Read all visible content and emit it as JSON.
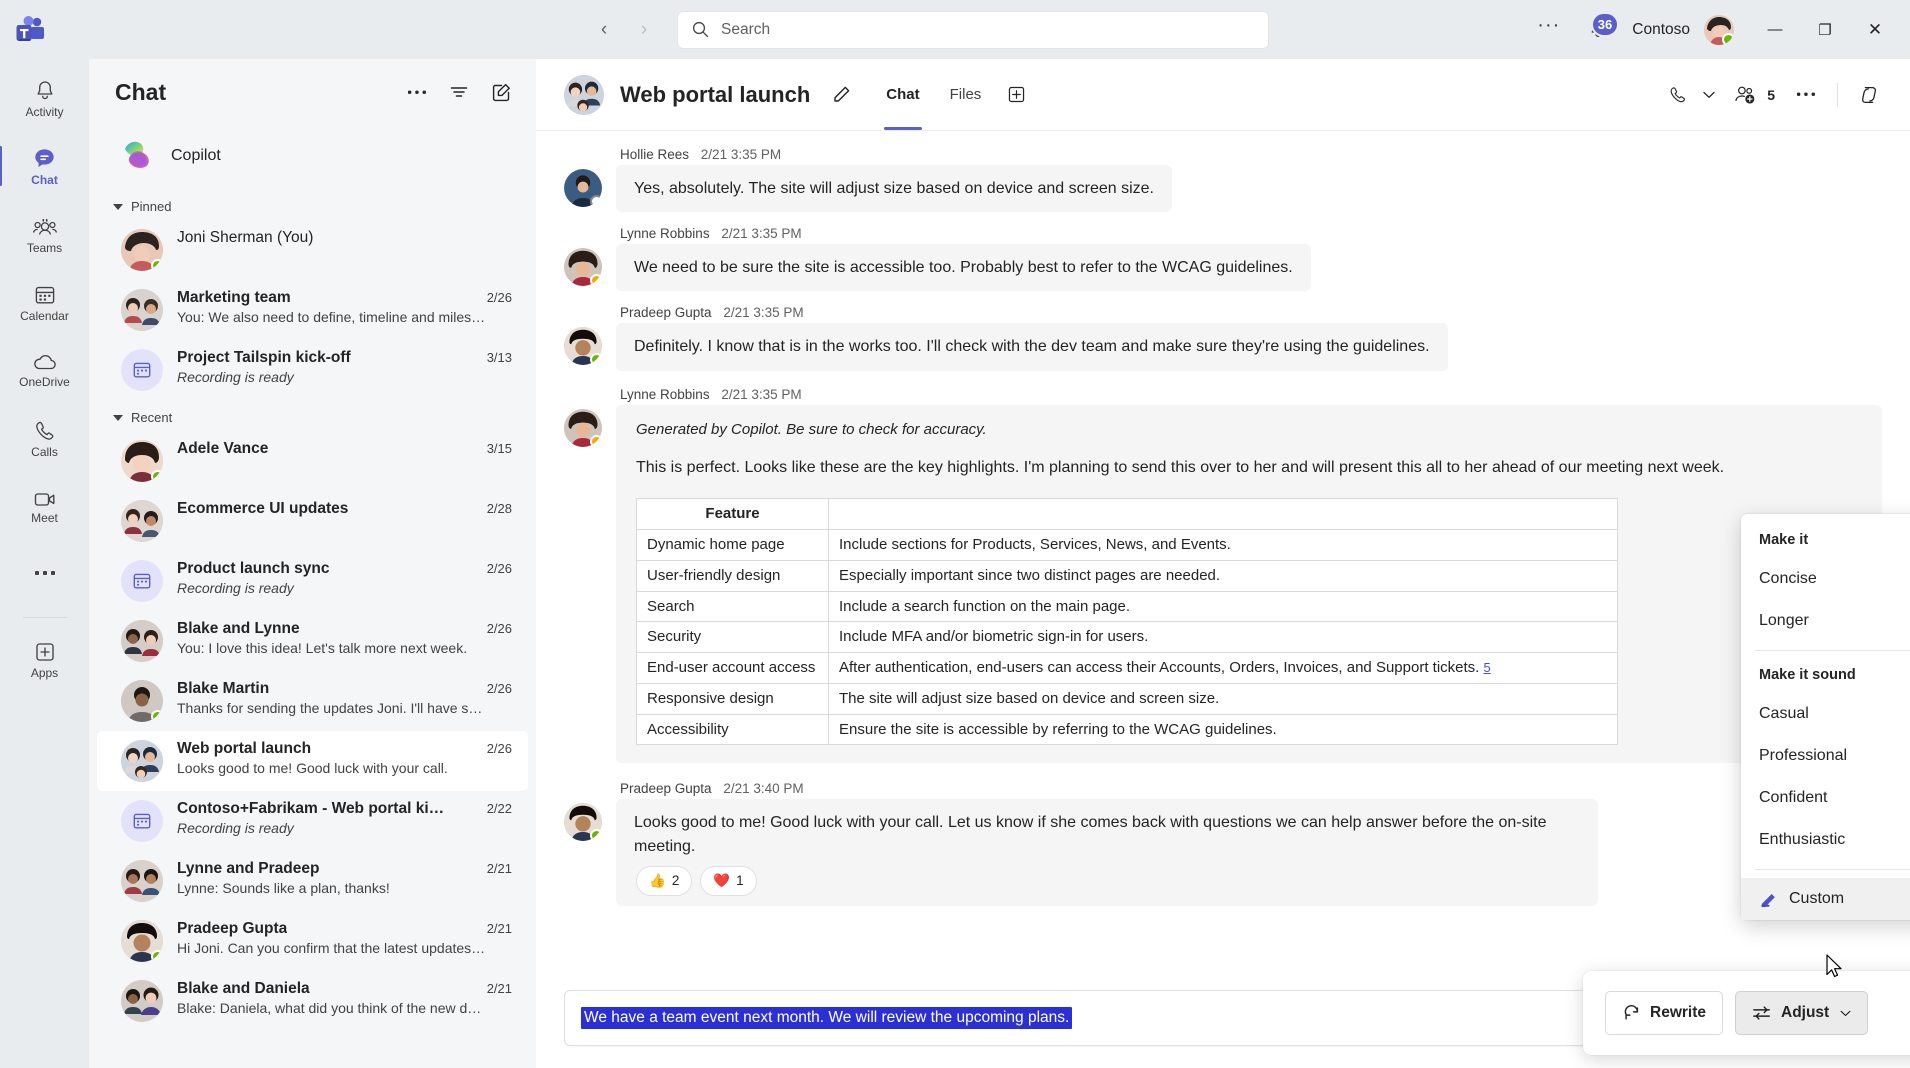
{
  "titlebar": {
    "logo_name": "teams-logo",
    "back_label": "‹",
    "forward_label": "›",
    "search_placeholder": "Search",
    "overflow_label": "···",
    "notification_count": "36",
    "org_name": "Contoso",
    "minimize_label": "—",
    "maximize_label": "❐",
    "close_label": "✕"
  },
  "rail": {
    "items": [
      {
        "label": "Activity",
        "icon": "bell-icon"
      },
      {
        "label": "Chat",
        "icon": "chat-icon"
      },
      {
        "label": "Teams",
        "icon": "teams-people-icon"
      },
      {
        "label": "Calendar",
        "icon": "calendar-icon"
      },
      {
        "label": "OneDrive",
        "icon": "cloud-icon"
      },
      {
        "label": "Calls",
        "icon": "phone-icon"
      },
      {
        "label": "Meet",
        "icon": "video-icon"
      },
      {
        "label": "",
        "icon": "more-icon"
      },
      {
        "label": "Apps",
        "icon": "apps-plus-icon"
      }
    ],
    "active_index": 1,
    "accent": "#5b5fc7"
  },
  "chatlist": {
    "title": "Chat",
    "actions": [
      "more-options-icon",
      "filter-icon",
      "compose-chat-icon"
    ],
    "copilot": {
      "label": "Copilot"
    },
    "groups": [
      {
        "label": "Pinned",
        "items": [
          {
            "name": "Joni Sherman (You)",
            "date": "",
            "preview": "",
            "icon": "avatar",
            "presence": "available"
          },
          {
            "name": "Marketing team",
            "date": "2/26",
            "preview": "You: We also need to define, timeline and miles…",
            "icon": "group-avatar",
            "presence": ""
          },
          {
            "name": "Project Tailspin kick-off",
            "date": "3/13",
            "preview": "Recording is ready",
            "preview_italic": true,
            "icon": "meeting-icon",
            "presence": ""
          }
        ]
      },
      {
        "label": "Recent",
        "items": [
          {
            "name": "Adele Vance",
            "date": "3/15",
            "preview": "",
            "icon": "avatar",
            "presence": "available"
          },
          {
            "name": "Ecommerce UI updates",
            "date": "2/28",
            "preview": "",
            "icon": "group-avatar",
            "presence": ""
          },
          {
            "name": "Product launch sync",
            "date": "2/26",
            "preview": "Recording is ready",
            "preview_italic": true,
            "icon": "meeting-icon",
            "presence": ""
          },
          {
            "name": "Blake and Lynne",
            "date": "2/26",
            "preview": "You: I love this idea! Let's talk more next week.",
            "icon": "group-avatar",
            "presence": ""
          },
          {
            "name": "Blake Martin",
            "date": "2/26",
            "preview": "Thanks for sending the updates Joni. I'll have s…",
            "icon": "avatar",
            "presence": "available"
          },
          {
            "name": "Web portal launch",
            "date": "2/26",
            "preview": "Looks good to me! Good luck with your call.",
            "icon": "group-avatar",
            "presence": "",
            "selected": true
          },
          {
            "name": "Contoso+Fabrikam - Web portal ki…",
            "date": "2/22",
            "preview": "Recording is ready",
            "preview_italic": true,
            "icon": "meeting-icon",
            "presence": ""
          },
          {
            "name": "Lynne and Pradeep",
            "date": "2/21",
            "preview": "Lynne: Sounds like a plan, thanks!",
            "icon": "group-avatar",
            "presence": ""
          },
          {
            "name": "Pradeep Gupta",
            "date": "2/21",
            "preview": "Hi Joni. Can you confirm that the latest updates…",
            "icon": "avatar",
            "presence": "available"
          },
          {
            "name": "Blake and Daniela",
            "date": "2/21",
            "preview": "Blake: Daniela, what did you think of the new d…",
            "icon": "group-avatar",
            "presence": ""
          }
        ]
      }
    ]
  },
  "chat_header": {
    "title": "Web portal launch",
    "edit_icon": "pencil-icon",
    "tabs": [
      {
        "label": "Chat",
        "active": true
      },
      {
        "label": "Files",
        "active": false
      }
    ],
    "add_tab_icon": "add-tab-icon",
    "call_icon": "phone-icon",
    "call_chevron": "chevron-down-icon",
    "people_icon": "add-people-icon",
    "people_count": "5",
    "more_icon": "more-options-icon",
    "copilot_icon": "copilot-icon"
  },
  "messages": [
    {
      "sender": "Hollie Rees",
      "time": "2/21 3:35 PM",
      "presence": "offline",
      "text": "Yes, absolutely. The site will adjust size based on device and screen size."
    },
    {
      "sender": "Lynne Robbins",
      "time": "2/21 3:35 PM",
      "presence": "away",
      "text": "We need to be sure the site is accessible too. Probably best to refer to the WCAG guidelines."
    },
    {
      "sender": "Pradeep Gupta",
      "time": "2/21 3:35 PM",
      "presence": "available",
      "text": "Definitely. I know that is in the works too. I'll check with the dev team and make sure they're using the guidelines."
    }
  ],
  "copilot_message": {
    "sender": "Lynne Robbins",
    "time": "2/21 3:35 PM",
    "presence": "away",
    "disclaimer": "Generated by Copilot. Be sure to check for accuracy.",
    "body": "This is perfect. Looks like these are the key highlights. I'm planning to send this over to her and will present this all to her ahead of our meeting next week.",
    "table": {
      "headers": [
        "Feature",
        ""
      ],
      "rows": [
        [
          "Dynamic home page",
          "Include sections for Products, Services, News, and Events."
        ],
        [
          "User-friendly design",
          "Especially important since two distinct pages are needed."
        ],
        [
          "Search",
          "Include a search function on the main page."
        ],
        [
          "Security",
          "Include MFA and/or biometric sign-in for users."
        ],
        [
          "End-user account access",
          "After authentication, end-users can access their Accounts, Orders, Invoices, and Support tickets."
        ],
        [
          "Responsive design",
          "The site will adjust size based on device and screen size."
        ],
        [
          "Accessibility",
          "Ensure the site is accessible by referring to the WCAG guidelines."
        ]
      ],
      "citation": "5"
    }
  },
  "last_message": {
    "sender": "Pradeep Gupta",
    "time": "2/21 3:40 PM",
    "presence": "available",
    "text": "Looks good to me! Good luck with your call. Let us know if she comes back with questions we can help answer before the on-site meeting.",
    "reactions": [
      {
        "emoji": "👍",
        "count": "2"
      },
      {
        "emoji": "❤️",
        "count": "1"
      }
    ]
  },
  "rewrite_toolbar": {
    "rewrite_label": "Rewrite",
    "rewrite_icon": "refresh-icon",
    "adjust_label": "Adjust",
    "adjust_icon": "sliders-icon",
    "adjust_chevron": "chevron-down-icon",
    "close_icon": "close-icon"
  },
  "adjust_dropdown": {
    "section1_title": "Make it",
    "section1_items": [
      "Concise",
      "Longer"
    ],
    "section2_title": "Make it sound",
    "section2_items": [
      "Casual",
      "Professional",
      "Confident",
      "Enthusiastic"
    ],
    "custom_label": "Custom",
    "custom_icon": "edit-pen-icon"
  },
  "compose": {
    "text": "We have a team event next month. We will review the upcoming plans.",
    "selection_color": "#2b30d4",
    "actions": [
      "format-icon",
      "emoji-icon",
      "copilot-icon",
      "loop-icon",
      "more-plus-icon",
      "send-icon"
    ]
  }
}
